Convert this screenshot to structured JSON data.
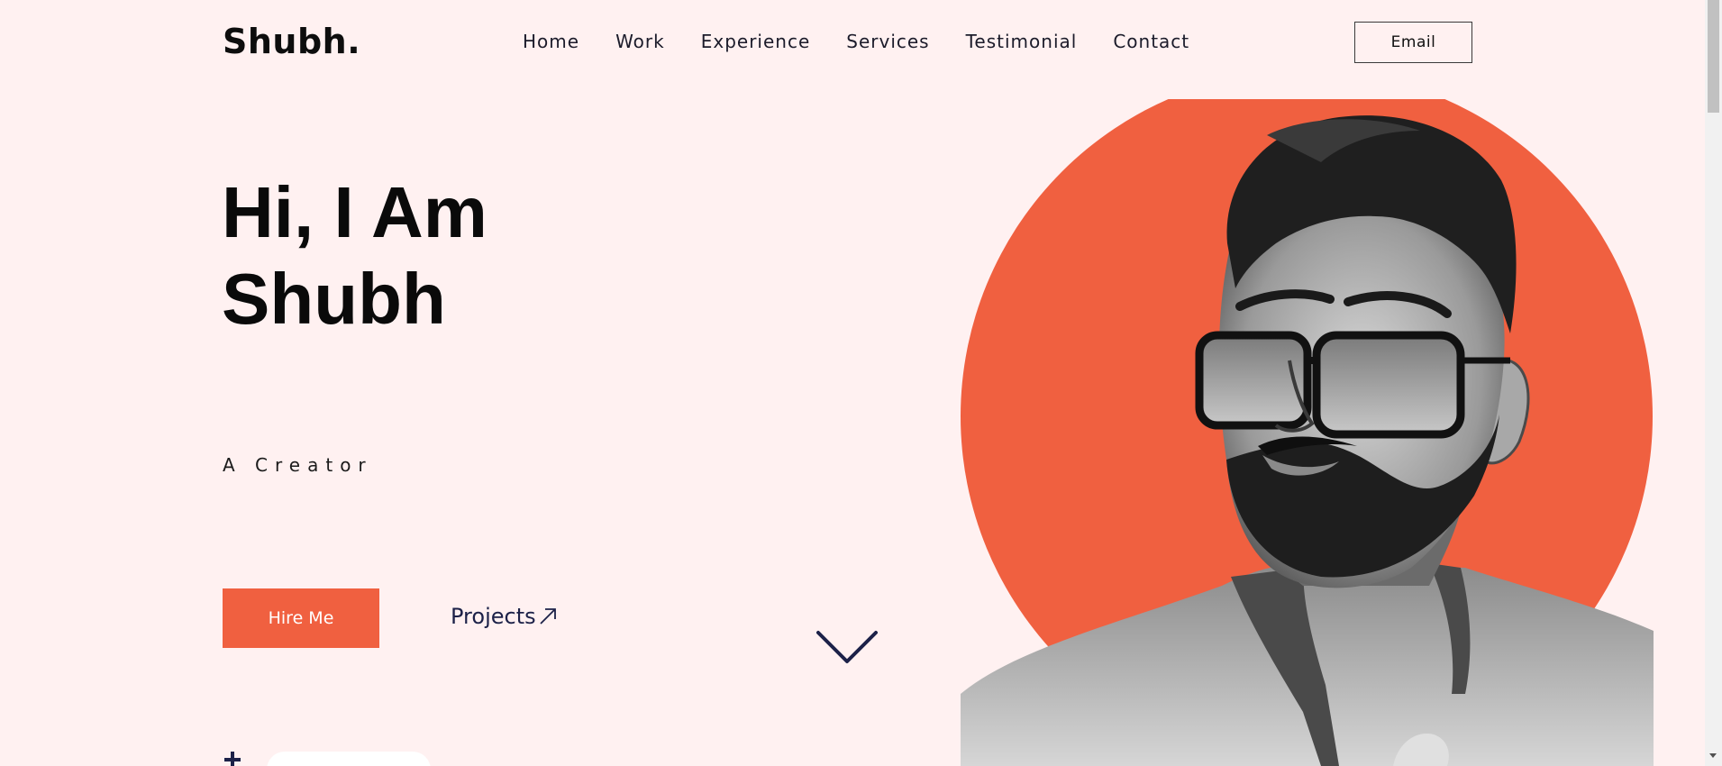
{
  "header": {
    "logo": "Shubh.",
    "nav": [
      "Home",
      "Work",
      "Experience",
      "Services",
      "Testimonial",
      "Contact"
    ],
    "email_label": "Email"
  },
  "hero": {
    "title_line1": "Hi, I Am",
    "title_line2": "Shubh",
    "subtitle": "A Creator",
    "hire_label": "Hire Me",
    "projects_label": "Projects"
  },
  "colors": {
    "accent": "#f06040",
    "background": "#fff1f1",
    "dark": "#1c2148"
  },
  "icons": {
    "projects_arrow": "arrow-up-right-icon",
    "scroll": "chevron-down-icon",
    "plus": "plus-icon"
  }
}
